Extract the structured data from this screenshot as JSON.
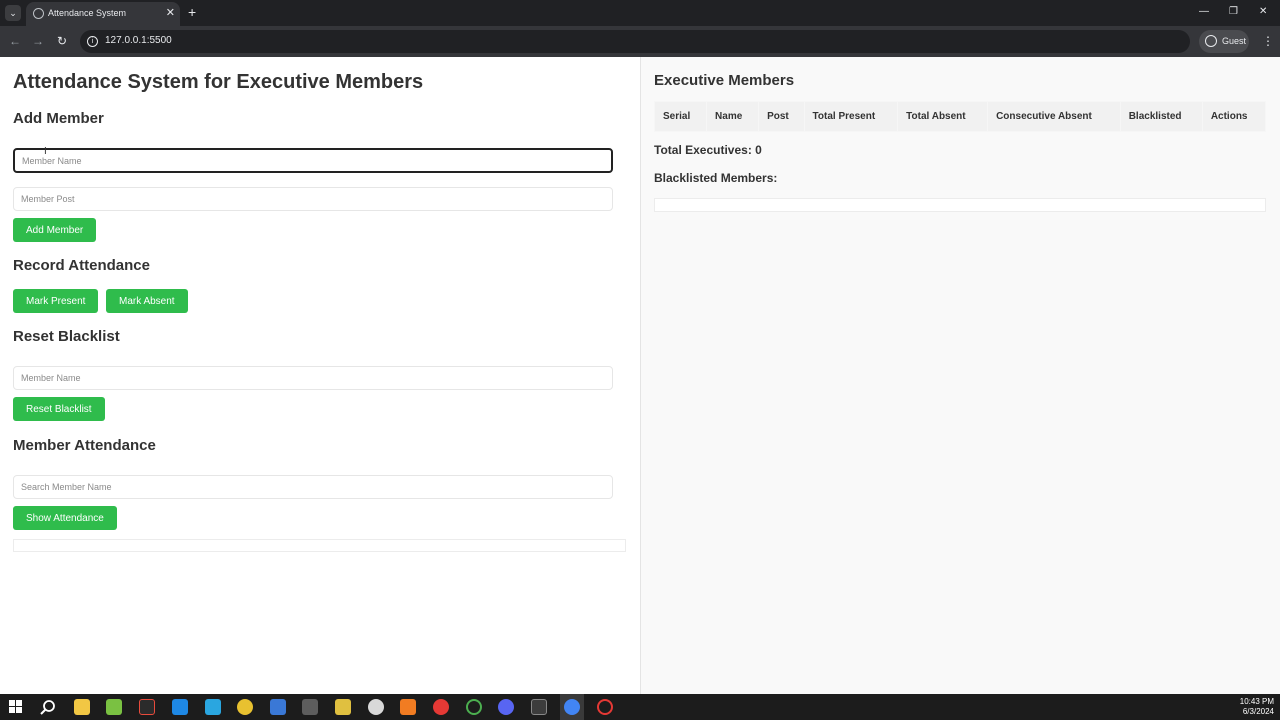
{
  "browser": {
    "tab_title": "Attendance System",
    "tab_close": "✕",
    "new_tab": "+",
    "url": "127.0.0.1:5500",
    "profile_label": "Guest",
    "back": "←",
    "forward": "→",
    "reload": "↻",
    "menu": "⋮",
    "tab_search": "⌄",
    "minimize": "—",
    "restore": "❐",
    "close": "✕"
  },
  "page": {
    "title": "Attendance System for Executive Members",
    "add_member": {
      "heading": "Add Member",
      "name_placeholder": "Member Name",
      "post_placeholder": "Member Post",
      "button": "Add Member"
    },
    "record_attendance": {
      "heading": "Record Attendance",
      "present_button": "Mark Present",
      "absent_button": "Mark Absent"
    },
    "reset_blacklist": {
      "heading": "Reset Blacklist",
      "name_placeholder": "Member Name",
      "button": "Reset Blacklist"
    },
    "member_attendance": {
      "heading": "Member Attendance",
      "search_placeholder": "Search Member Name",
      "button": "Show Attendance"
    }
  },
  "executives": {
    "heading": "Executive Members",
    "columns": [
      "Serial",
      "Name",
      "Post",
      "Total Present",
      "Total Absent",
      "Consecutive Absent",
      "Blacklisted",
      "Actions"
    ],
    "total_label": "Total Executives: 0",
    "blacklisted_label": "Blacklisted Members:"
  },
  "taskbar": {
    "time": "10:43 PM",
    "date": "6/3/2024",
    "icons": [
      "windows-start",
      "search",
      "file-explorer",
      "notepad",
      "app",
      "vscode",
      "app",
      "chrome",
      "app",
      "git",
      "app",
      "app",
      "xampp",
      "app",
      "app",
      "discord",
      "terminal",
      "chrome",
      "app"
    ]
  }
}
